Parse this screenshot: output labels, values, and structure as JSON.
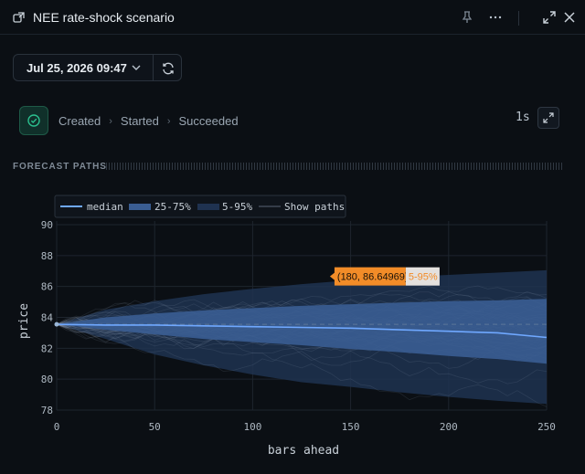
{
  "window": {
    "title": "NEE rate-shock scenario",
    "icons": [
      "link-out-icon",
      "pin-icon",
      "more-icon",
      "maximize-icon",
      "close-icon"
    ]
  },
  "toolbar": {
    "datetime": "Jul 25, 2026 09:47",
    "datetime_icon": "chevron-down-icon",
    "refresh_icon": "refresh-icon"
  },
  "status": {
    "icon": "check-circle-icon",
    "steps": [
      "Created",
      "Started",
      "Succeeded"
    ],
    "duration": "1s",
    "state_color": "#2bbf8e"
  },
  "section": {
    "heading": "FORECAST PATHS"
  },
  "chart_data": {
    "type": "area",
    "xlabel": "bars ahead",
    "ylabel": "price",
    "xlim": [
      0,
      250
    ],
    "ylim": [
      78,
      90
    ],
    "xticks": [
      0,
      50,
      100,
      150,
      200,
      250
    ],
    "yticks": [
      78,
      80,
      82,
      84,
      86,
      88,
      90
    ],
    "grid": true,
    "legend": {
      "placement": "top-left",
      "entries": [
        "median",
        "25-75%",
        "5-95%",
        "Show paths"
      ]
    },
    "start_value": 83.55,
    "reference_line": 83.55,
    "x": [
      0,
      25,
      50,
      75,
      100,
      125,
      150,
      175,
      200,
      225,
      250
    ],
    "series": [
      {
        "name": "median",
        "values": [
          83.55,
          83.5,
          83.5,
          83.45,
          83.4,
          83.35,
          83.3,
          83.2,
          83.1,
          83.0,
          82.7
        ]
      },
      {
        "name": "25-75%",
        "lower": [
          83.55,
          83.2,
          82.9,
          82.6,
          82.4,
          82.2,
          81.95,
          81.75,
          81.5,
          81.3,
          81.0
        ],
        "upper": [
          83.55,
          84.0,
          84.25,
          84.45,
          84.6,
          84.75,
          84.85,
          84.95,
          85.05,
          85.1,
          85.2
        ]
      },
      {
        "name": "5-95%",
        "lower": [
          83.55,
          82.6,
          81.6,
          80.9,
          80.3,
          79.8,
          79.5,
          79.15,
          78.85,
          78.6,
          78.4
        ],
        "upper": [
          83.55,
          84.5,
          85.05,
          85.5,
          85.85,
          86.15,
          86.4,
          86.6,
          86.75,
          86.9,
          87.05
        ]
      }
    ],
    "tooltip": {
      "point": "(180, 86.64969)",
      "series": "5-95%",
      "x": 180,
      "y": 86.64969
    },
    "colors": {
      "median": "#6fa8ff",
      "band_inner": "#3a5d92",
      "band_outer": "#1f3250",
      "paths": "#9fb2c8",
      "tooltip_bg": "#f28c28",
      "tooltip_tag_bg": "#e4e1de"
    }
  }
}
